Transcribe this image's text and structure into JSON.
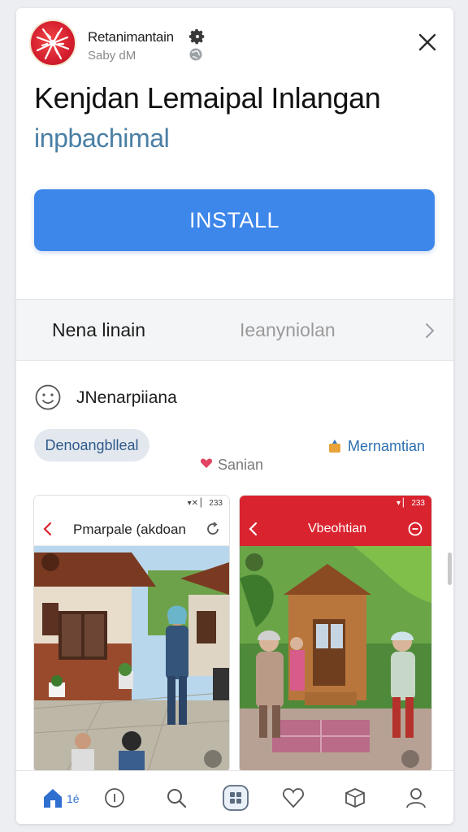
{
  "header": {
    "app_name": "Retanimantain",
    "app_sub": "Saby dM",
    "settings_icon": "gear-icon",
    "globe_icon": "globe-icon",
    "close_icon": "close-icon"
  },
  "title": "Kenjdan Lemaipal  Inlangan",
  "subtitle": "inpbachimal",
  "install_label": "INSTALL",
  "info_row": {
    "left": "Nena linain",
    "middle": "Ieanyniolan",
    "chevron_icon": "chevron-right-icon"
  },
  "profile": {
    "icon": "smile-icon",
    "name": "JNenarpiiana"
  },
  "tags": {
    "pill": "Denoangblleal",
    "heart_label": "Sanian",
    "link": "Mernamtian"
  },
  "screenshots": [
    {
      "status": "▾✕ ▏ 233",
      "title": "Pmarpale (akdoan"
    },
    {
      "status": "▾ ▏ 233",
      "title": "Vbeohtian"
    }
  ],
  "bottom_nav": {
    "home_label": "1é",
    "items": [
      "home-icon",
      "info-icon",
      "search-icon",
      "apps-icon",
      "heart-icon",
      "cube-icon",
      "person-icon"
    ]
  },
  "colors": {
    "accent": "#3d86ea",
    "brand_red": "#d9242f",
    "subtitle": "#4a7fa5",
    "link": "#2c6fb0"
  }
}
